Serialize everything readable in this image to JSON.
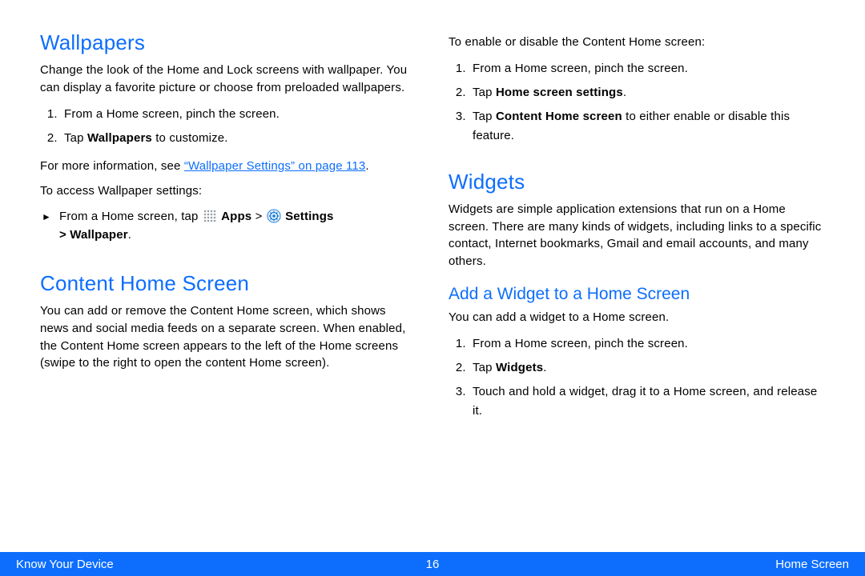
{
  "left": {
    "wallpapers": {
      "title": "Wallpapers",
      "desc": "Change the look of the Home and Lock screens with wallpaper. You can display a favorite picture or choose from preloaded wallpapers.",
      "steps": [
        {
          "pre": "From a Home screen, pinch the screen."
        },
        {
          "pre": "Tap ",
          "bold": "Wallpapers",
          "post": " to customize."
        }
      ],
      "xref_pre": "For more information, see ",
      "xref_link": "“Wallpaper Settings” on page 113",
      "xref_post": ".",
      "access_intro": "To access Wallpaper settings:",
      "bullet_pre": "From a Home screen, tap ",
      "apps_label": "Apps",
      "gt1": " >  ",
      "settings_label": "Settings",
      "bullet_line2": "> Wallpaper",
      "bullet_post": "."
    },
    "content_home": {
      "title": "Content Home Screen",
      "desc": "You can add or remove the Content Home screen, which shows news and social media feeds on a separate screen. When enabled, the Content Home screen appears to the left of the Home screens (swipe to the right to open the content Home screen)."
    }
  },
  "right": {
    "content_steps_intro": "To enable or disable the Content Home screen:",
    "content_steps": [
      {
        "pre": "From a Home screen, pinch the screen."
      },
      {
        "pre": "Tap ",
        "bold": "Home screen settings",
        "post": "."
      },
      {
        "pre": "Tap ",
        "bold": "Content Home screen",
        "post": " to either enable or disable this feature."
      }
    ],
    "widgets": {
      "title": "Widgets",
      "desc": "Widgets are simple application extensions that run on a Home screen. There are many kinds of widgets, including links to a specific contact, Internet bookmarks, Gmail and email accounts, and many others."
    },
    "add_widget": {
      "title": "Add a Widget to a Home Screen",
      "desc": "You can add a widget to a Home screen.",
      "steps": [
        {
          "pre": "From a Home screen, pinch the screen."
        },
        {
          "pre": "Tap ",
          "bold": "Widgets",
          "post": "."
        },
        {
          "pre": "Touch and hold a widget, drag it to a Home screen, and release it."
        }
      ]
    }
  },
  "footer": {
    "left": "Know Your Device",
    "center": "16",
    "right": "Home Screen"
  }
}
